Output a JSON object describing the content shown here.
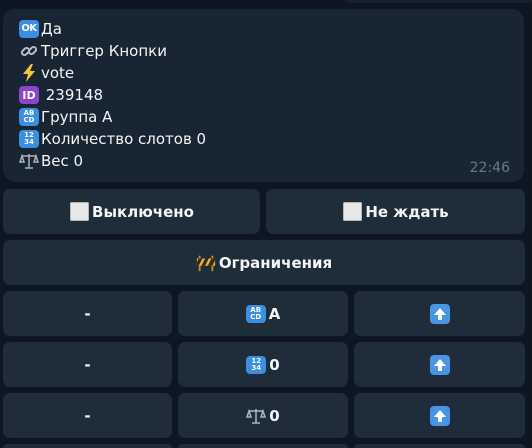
{
  "message": {
    "lines": [
      {
        "icon": "ok-icon",
        "text": "Да"
      },
      {
        "icon": "link-icon",
        "text": "Триггер Кнопки"
      },
      {
        "icon": "lightning-icon",
        "text": "vote"
      },
      {
        "icon": "id-icon",
        "text": " 239148"
      },
      {
        "icon": "abcd-icon",
        "text": "Группа A"
      },
      {
        "icon": "numbers-icon",
        "text": "Количество слотов 0"
      },
      {
        "icon": "scales-icon",
        "text": "Вес 0"
      }
    ],
    "time": "22:46",
    "icon_labels": {
      "ok": "OK",
      "id": "ID",
      "abcd_top": "AB",
      "abcd_bottom": "CD",
      "num_top": "12",
      "num_bottom": "34"
    }
  },
  "keyboard": {
    "row1": [
      {
        "icon": "white-square-icon",
        "label": "Выключено"
      },
      {
        "icon": "white-square-icon",
        "label": "Не ждать"
      }
    ],
    "restrictions": {
      "icon": "construction-barrier-icon",
      "label": "Ограничения"
    },
    "rows": [
      [
        {
          "label": "-"
        },
        {
          "icon": "abcd-icon",
          "label": "A"
        },
        {
          "icon": "up-arrow-icon",
          "label": ""
        }
      ],
      [
        {
          "label": "-"
        },
        {
          "icon": "numbers-icon",
          "label": "0"
        },
        {
          "icon": "up-arrow-icon",
          "label": ""
        }
      ],
      [
        {
          "label": "-"
        },
        {
          "icon": "scales-icon",
          "label": "0"
        },
        {
          "icon": "up-arrow-icon",
          "label": ""
        }
      ]
    ]
  },
  "colors": {
    "background": "#0e1621",
    "bubble": "#182533",
    "button": "#1f2c3a",
    "accent_blue": "#3b8fe0",
    "time": "#6c7883"
  }
}
